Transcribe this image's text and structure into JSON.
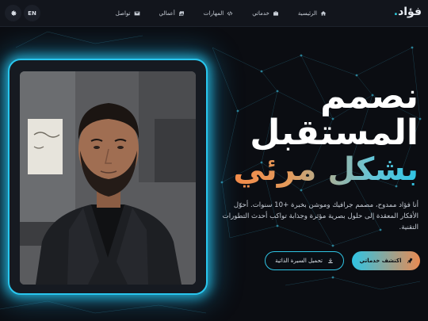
{
  "nav": {
    "logo_text": "فؤاد",
    "logo_dot": ".",
    "lang": "EN",
    "items": [
      {
        "label": "الرئيسية",
        "icon": "home-icon"
      },
      {
        "label": "خدماتي",
        "icon": "briefcase-icon"
      },
      {
        "label": "المهارات",
        "icon": "code-icon"
      },
      {
        "label": "أعمالي",
        "icon": "images-icon"
      },
      {
        "label": "تواصل",
        "icon": "envelope-icon"
      }
    ],
    "theme_icon": "gear-icon"
  },
  "hero": {
    "line1": "نصمم",
    "line2": "المستقبل",
    "line3": "بشكل مرئي",
    "description": "أنا فؤاد ممدوح، مصمم جرافيك وموشن بخبرة +10 سنوات. أحوّل الأفكار المعقدة إلى حلول بصرية مؤثرة وجذابة تواكب أحدث التطورات التقنية."
  },
  "buttons": {
    "primary_label": "اكتشف خدماتي",
    "primary_icon": "rocket-icon",
    "secondary_label": "تحميل السيرة الذاتية",
    "secondary_icon": "download-icon"
  },
  "colors": {
    "accent_cyan": "#2fc4e4",
    "accent_orange": "#e98a52",
    "background": "#0b0d12"
  }
}
